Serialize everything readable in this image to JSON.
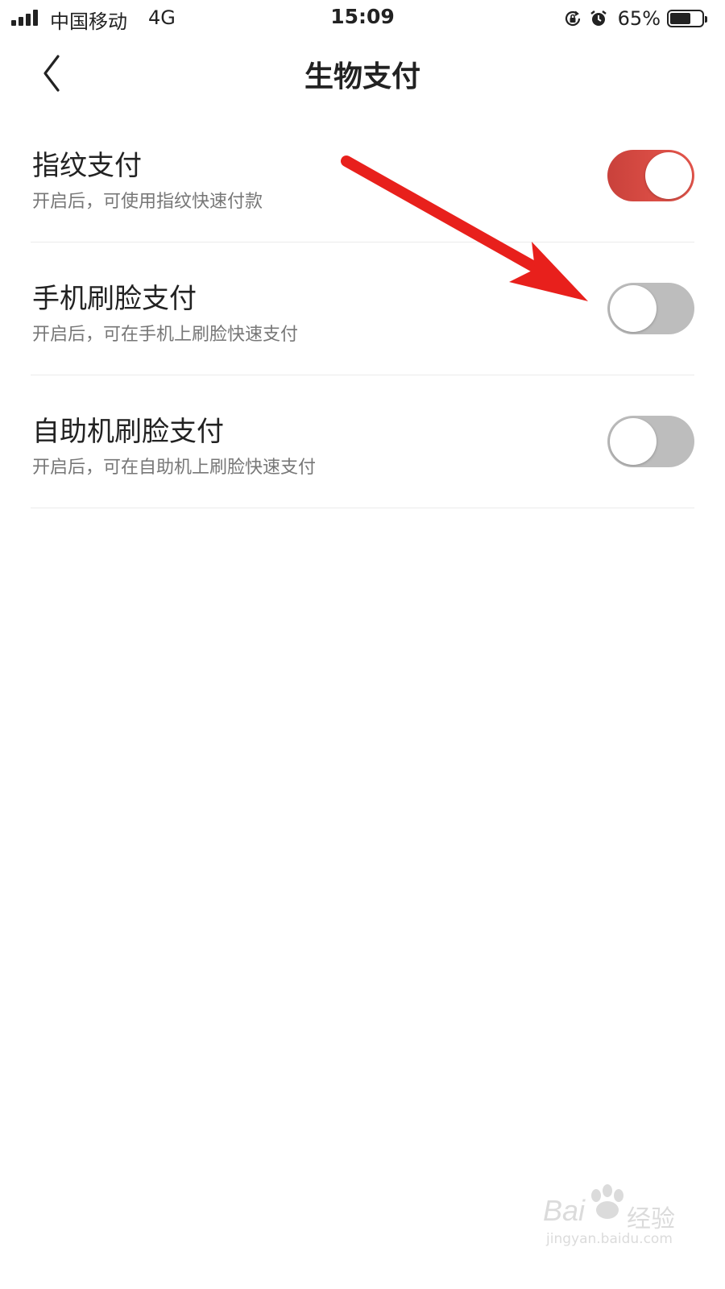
{
  "status_bar": {
    "carrier": "中国移动",
    "network": "4G",
    "time": "15:09",
    "battery_percent": "65%",
    "battery_level": 0.65,
    "signal_bars": 4,
    "icons": [
      "signal-icon",
      "rotation-lock-icon",
      "alarm-icon",
      "battery-icon"
    ]
  },
  "nav": {
    "title": "生物支付",
    "back_icon": "chevron-left-icon"
  },
  "settings": [
    {
      "title": "指纹支付",
      "description": "开启后，可使用指纹快速付款",
      "enabled": true
    },
    {
      "title": "手机刷脸支付",
      "description": "开启后，可在手机上刷脸快速支付",
      "enabled": false
    },
    {
      "title": "自助机刷脸支付",
      "description": "开启后，可在自助机上刷脸快速支付",
      "enabled": false
    }
  ],
  "colors": {
    "toggle_on": "#e0504a",
    "toggle_off": "#bdbdbd",
    "annotation_arrow": "#e8201c"
  },
  "watermark": {
    "brand": "Bai",
    "brand_sub": "经验",
    "url": "jingyan.baidu.com"
  }
}
